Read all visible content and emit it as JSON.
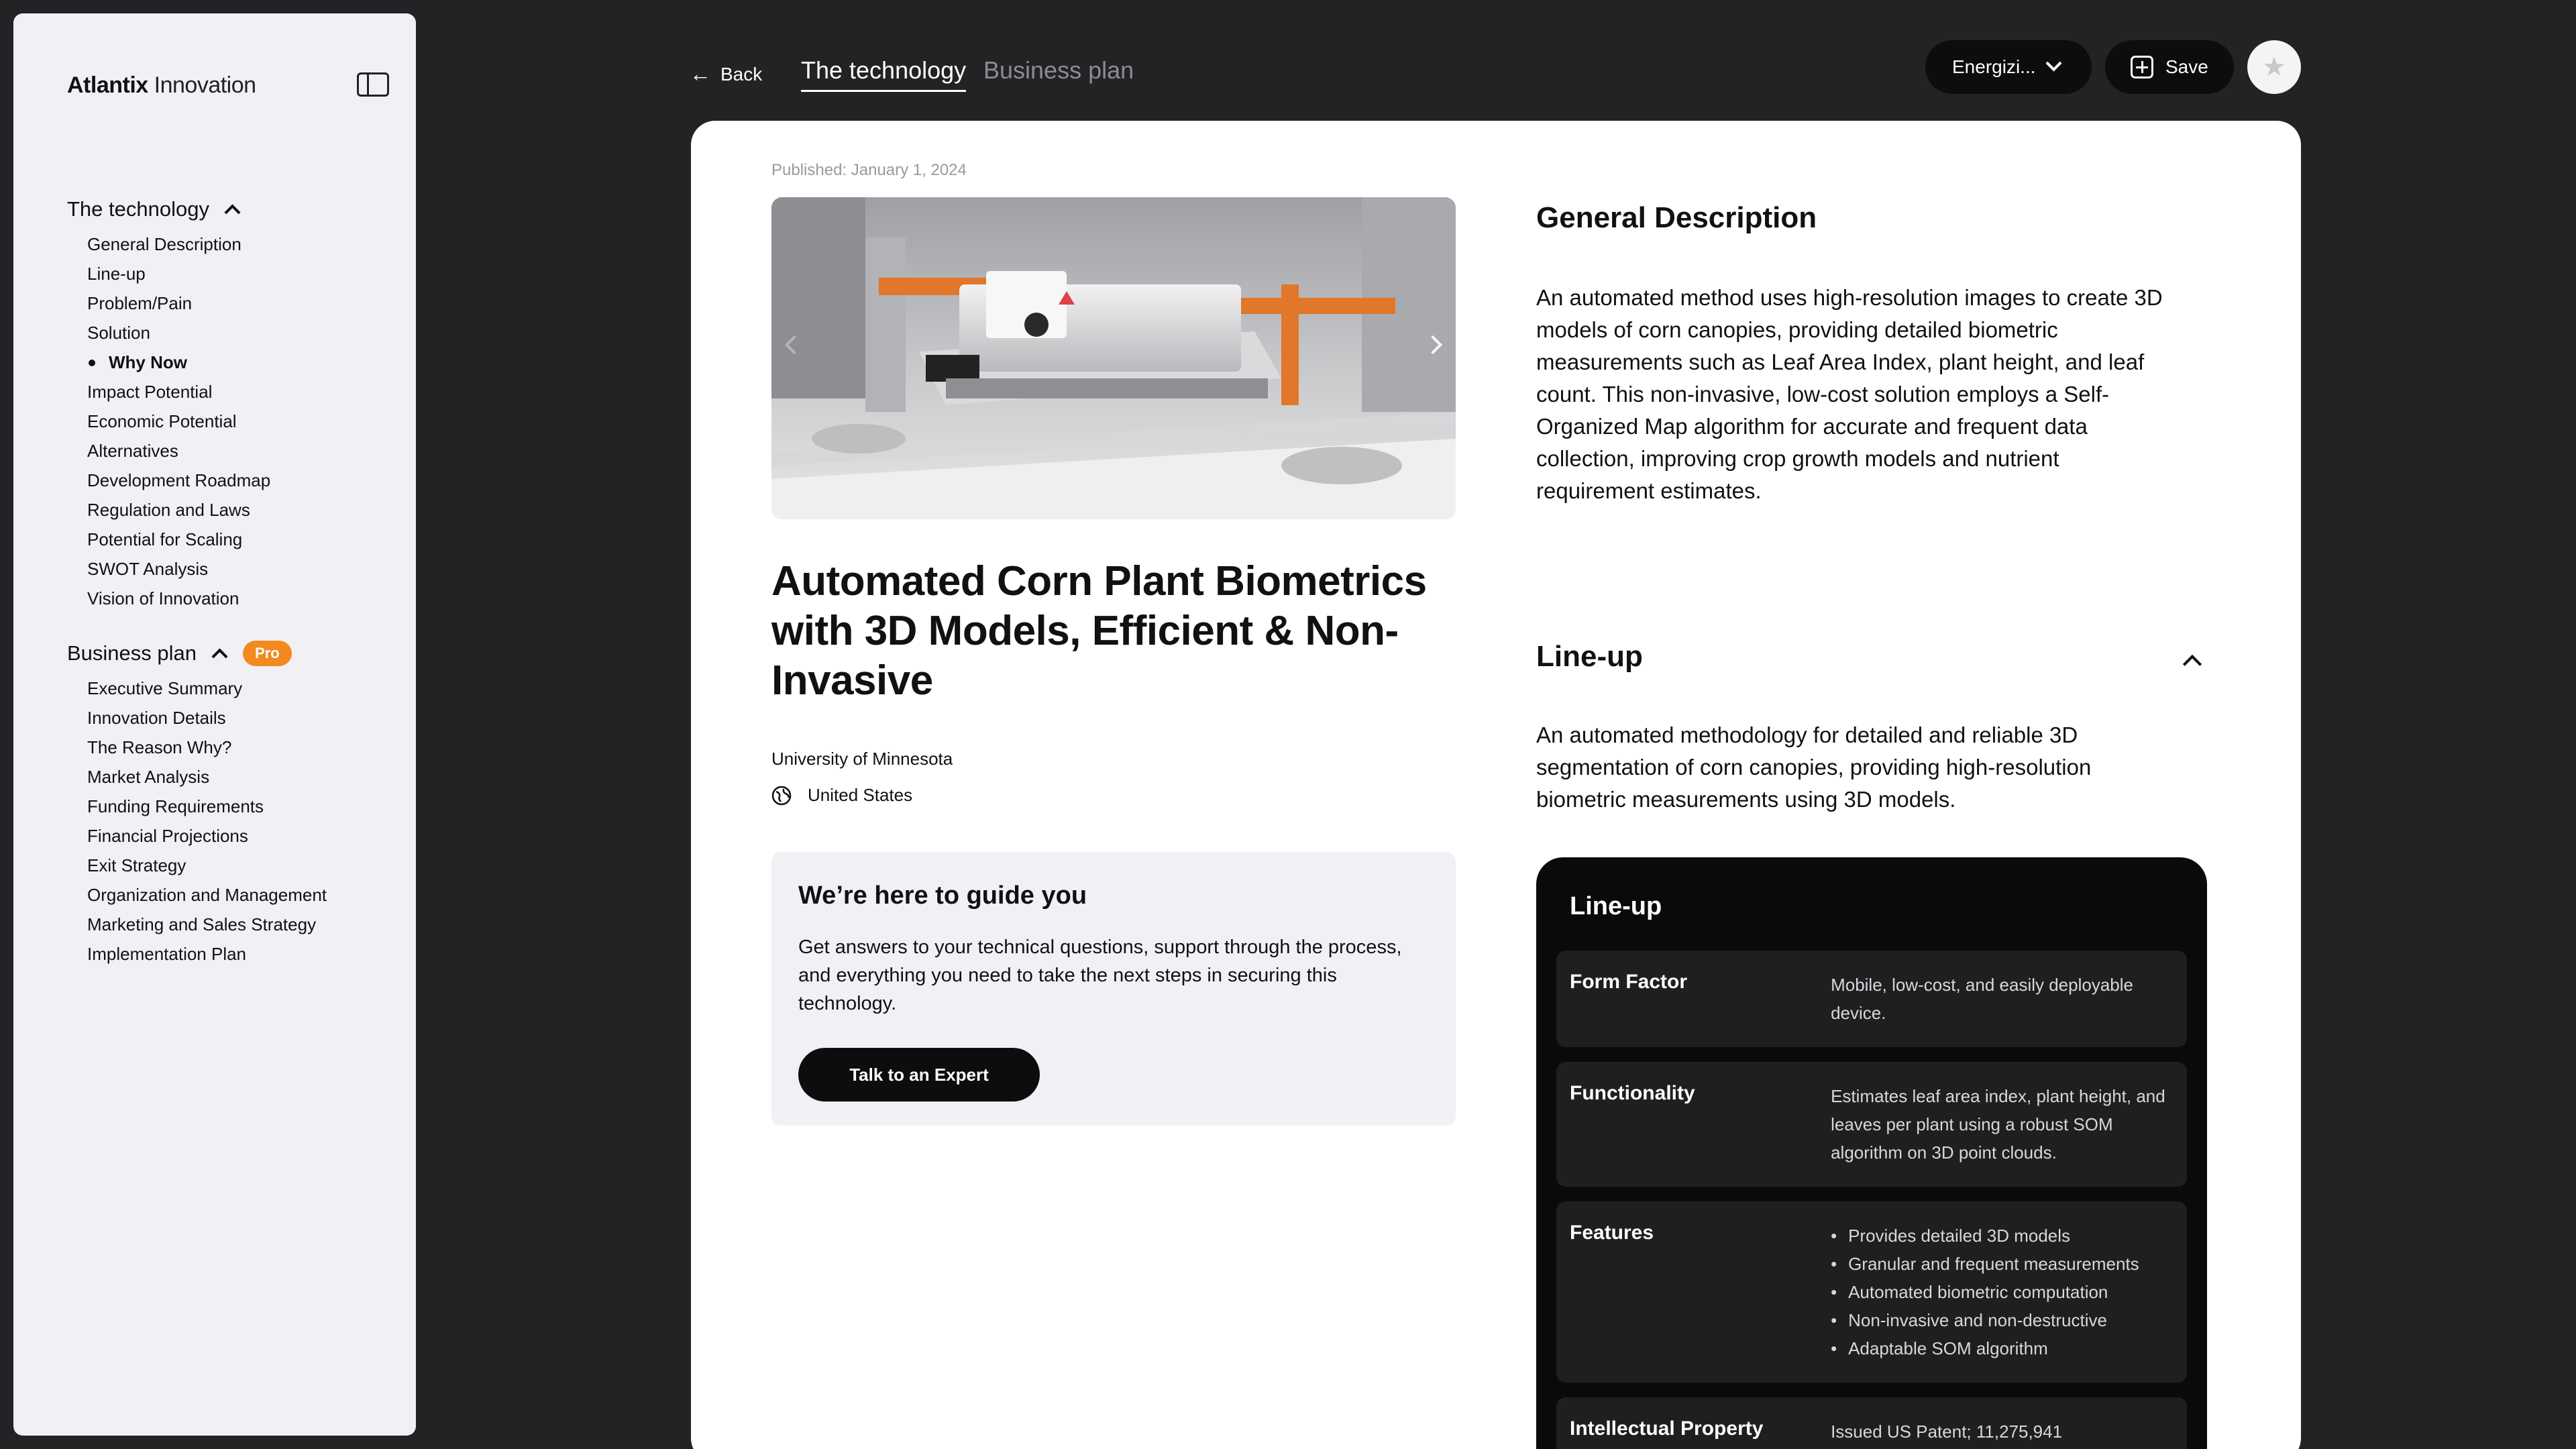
{
  "brand": {
    "name_bold": "Atlantix",
    "name_light": "Innovation"
  },
  "sidebar": {
    "technology": {
      "title": "The technology",
      "items": [
        "General Description",
        "Line-up",
        "Problem/Pain",
        "Solution",
        "Why Now",
        "Impact Potential",
        "Economic Potential",
        "Alternatives",
        "Development Roadmap",
        "Regulation and Laws",
        "Potential for Scaling",
        "SWOT Analysis",
        "Vision of Innovation"
      ],
      "active_item": "Why Now"
    },
    "business": {
      "title": "Business plan",
      "badge": "Pro",
      "items": [
        "Executive Summary",
        "Innovation Details",
        "The Reason Why?",
        "Market Analysis",
        "Funding Requirements",
        "Financial Projections",
        "Exit Strategy",
        "Organization and Management",
        "Marketing and Sales Strategy",
        "Implementation Plan"
      ]
    }
  },
  "topbar": {
    "back_label": "Back",
    "tab_active": "The technology",
    "tab_inactive": "Business plan",
    "dropdown_value": "Energizi...",
    "save_label": "Save",
    "avatar_glyph": "★"
  },
  "article": {
    "published": "Published: January 1, 2024",
    "title": "Automated Corn Plant Biometrics with 3D Models, Efficient & Non-Invasive",
    "institution": "University of Minnesota",
    "country": "United States"
  },
  "guide": {
    "heading": "We’re here to guide you",
    "text": "Get answers to your technical questions, support through the process, and everything you need to take the next steps in securing this technology.",
    "button": "Talk to an Expert"
  },
  "general": {
    "heading": "General Description",
    "text": "An automated method uses high-resolution images to create 3D models of corn canopies, providing detailed biometric measurements such as Leaf Area Index, plant height, and leaf count. This non-invasive, low-cost solution employs a Self-Organized Map algorithm for accurate and frequent data collection, improving crop growth models and nutrient requirement estimates."
  },
  "lineup": {
    "heading": "Line-up",
    "text": "An automated methodology for detailed and reliable 3D segmentation of corn canopies, providing high-resolution biometric measurements using 3D models.",
    "panel_title": "Line-up",
    "rows": [
      {
        "key": "Form Factor",
        "value": "Mobile, low-cost, and easily deployable device."
      },
      {
        "key": "Functionality",
        "value": "Estimates leaf area index, plant height, and leaves per plant using a robust SOM algorithm on 3D point clouds."
      },
      {
        "key": "Features",
        "bullets": [
          "Provides detailed 3D models",
          "Granular and frequent measurements",
          "Automated biometric computation",
          "Non-invasive and non-destructive",
          "Adaptable SOM algorithm"
        ]
      },
      {
        "key": "Intellectual Property",
        "value": "Issued US Patent; 11,275,941"
      }
    ]
  }
}
